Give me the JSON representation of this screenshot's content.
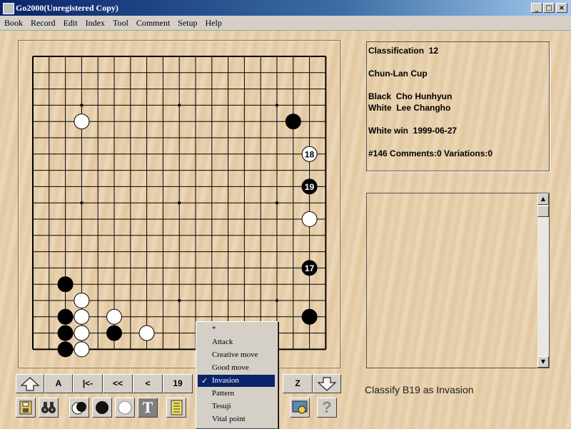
{
  "window": {
    "title": "Go2000(Unregistered Copy)",
    "minimize": "_",
    "maximize": "□",
    "close": "×"
  },
  "menu": [
    "Book",
    "Record",
    "Edit",
    "Index",
    "Tool",
    "Comment",
    "Setup",
    "Help"
  ],
  "board": {
    "size": 19,
    "stones": [
      {
        "col": 3,
        "row": 4,
        "color": "white"
      },
      {
        "col": 16,
        "row": 4,
        "color": "black"
      },
      {
        "col": 17,
        "row": 6,
        "color": "white",
        "label": "18"
      },
      {
        "col": 17,
        "row": 8,
        "color": "black",
        "label": "19"
      },
      {
        "col": 17,
        "row": 10,
        "color": "white"
      },
      {
        "col": 17,
        "row": 13,
        "color": "black",
        "label": "17"
      },
      {
        "col": 2,
        "row": 14,
        "color": "black"
      },
      {
        "col": 3,
        "row": 15,
        "color": "white"
      },
      {
        "col": 2,
        "row": 16,
        "color": "black"
      },
      {
        "col": 3,
        "row": 16,
        "color": "white"
      },
      {
        "col": 5,
        "row": 16,
        "color": "white"
      },
      {
        "col": 2,
        "row": 17,
        "color": "black"
      },
      {
        "col": 3,
        "row": 17,
        "color": "white"
      },
      {
        "col": 5,
        "row": 17,
        "color": "black"
      },
      {
        "col": 7,
        "row": 17,
        "color": "white"
      },
      {
        "col": 2,
        "row": 18,
        "color": "black"
      },
      {
        "col": 3,
        "row": 18,
        "color": "white"
      },
      {
        "col": 14,
        "row": 17,
        "color": "black"
      },
      {
        "col": 17,
        "row": 16,
        "color": "black"
      }
    ]
  },
  "info": {
    "classification": "Classification  12",
    "event": "Chun-Lan Cup",
    "black": "Black  Cho Hunhyun",
    "white": "White  Lee Changho",
    "result": "White win  1999-06-27",
    "move_info": "#146 Comments:0 Variations:0"
  },
  "comment_scrollbar": {
    "up": "▲",
    "down": "▼"
  },
  "navigation": {
    "first": "A",
    "start": "|<-",
    "back_fast": "<<",
    "back": "<",
    "move_number": "19",
    "end": "Z"
  },
  "status_text": "Classify B19 as Invasion",
  "classify_menu": {
    "items": [
      "*",
      "Attack",
      "Creative move",
      "Good move",
      "Invasion",
      "Pattern",
      "Tesuji",
      "Vital point"
    ],
    "selected": "Invasion",
    "check": "✓"
  },
  "toolbar": {
    "text_tool": "T",
    "help": "?"
  },
  "colors": {
    "titlebar": "#0a246a",
    "menu_bg": "#d4d0c8",
    "board_line": "#000000",
    "selection": "#0a246a"
  }
}
